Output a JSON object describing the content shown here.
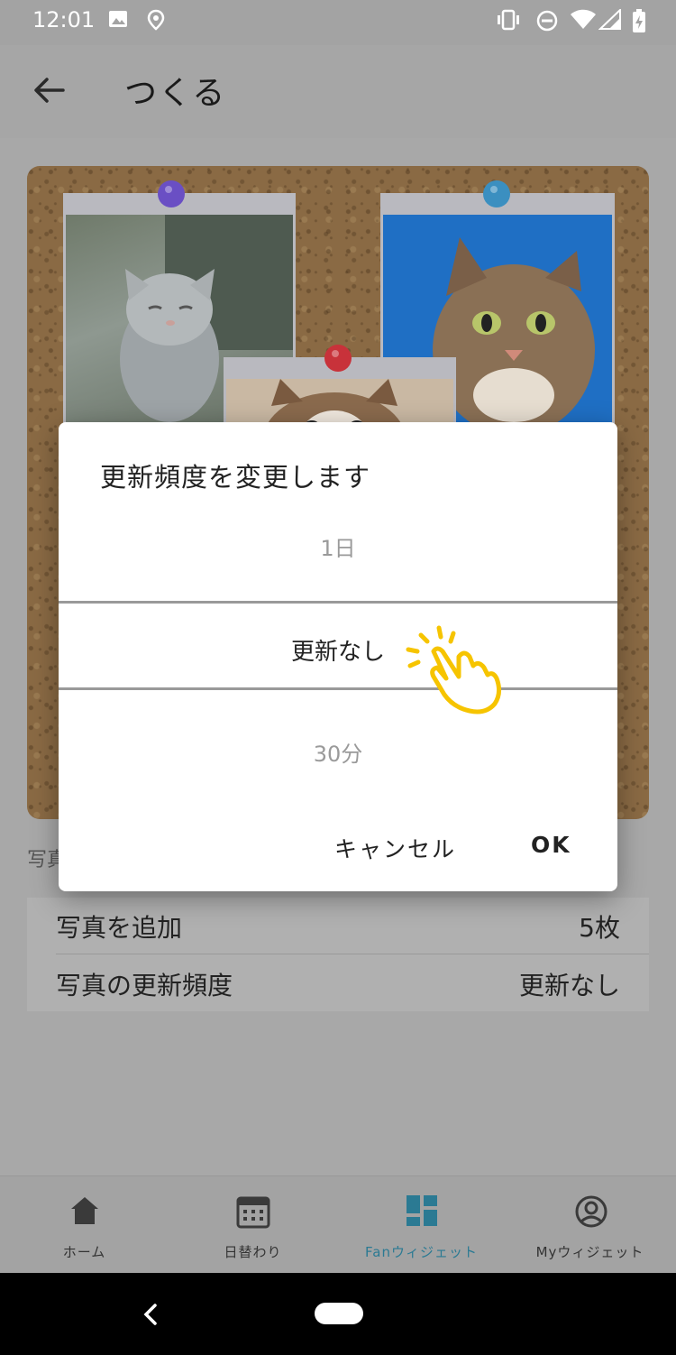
{
  "status_bar": {
    "time": "12:01"
  },
  "app_bar": {
    "title": "つくる"
  },
  "settings": {
    "section_label": "写真",
    "rows": [
      {
        "label": "写真を追加",
        "value": "5枚"
      },
      {
        "label": "写真の更新頻度",
        "value": "更新なし"
      }
    ]
  },
  "dialog": {
    "title": "更新頻度を変更します",
    "options": {
      "previous": "1日",
      "selected": "更新なし",
      "next": "30分"
    },
    "cancel_label": "キャンセル",
    "ok_label": "OK"
  },
  "bottom_nav": {
    "items": [
      {
        "label": "ホーム",
        "icon": "home-icon",
        "active": false
      },
      {
        "label": "日替わり",
        "icon": "calendar-icon",
        "active": false
      },
      {
        "label": "Fanウィジェット",
        "icon": "widget-grid-icon",
        "active": true
      },
      {
        "label": "Myウィジェット",
        "icon": "account-icon",
        "active": false
      }
    ]
  },
  "colors": {
    "accent": "#2b7a93",
    "hand_pointer": "#f6c400"
  }
}
